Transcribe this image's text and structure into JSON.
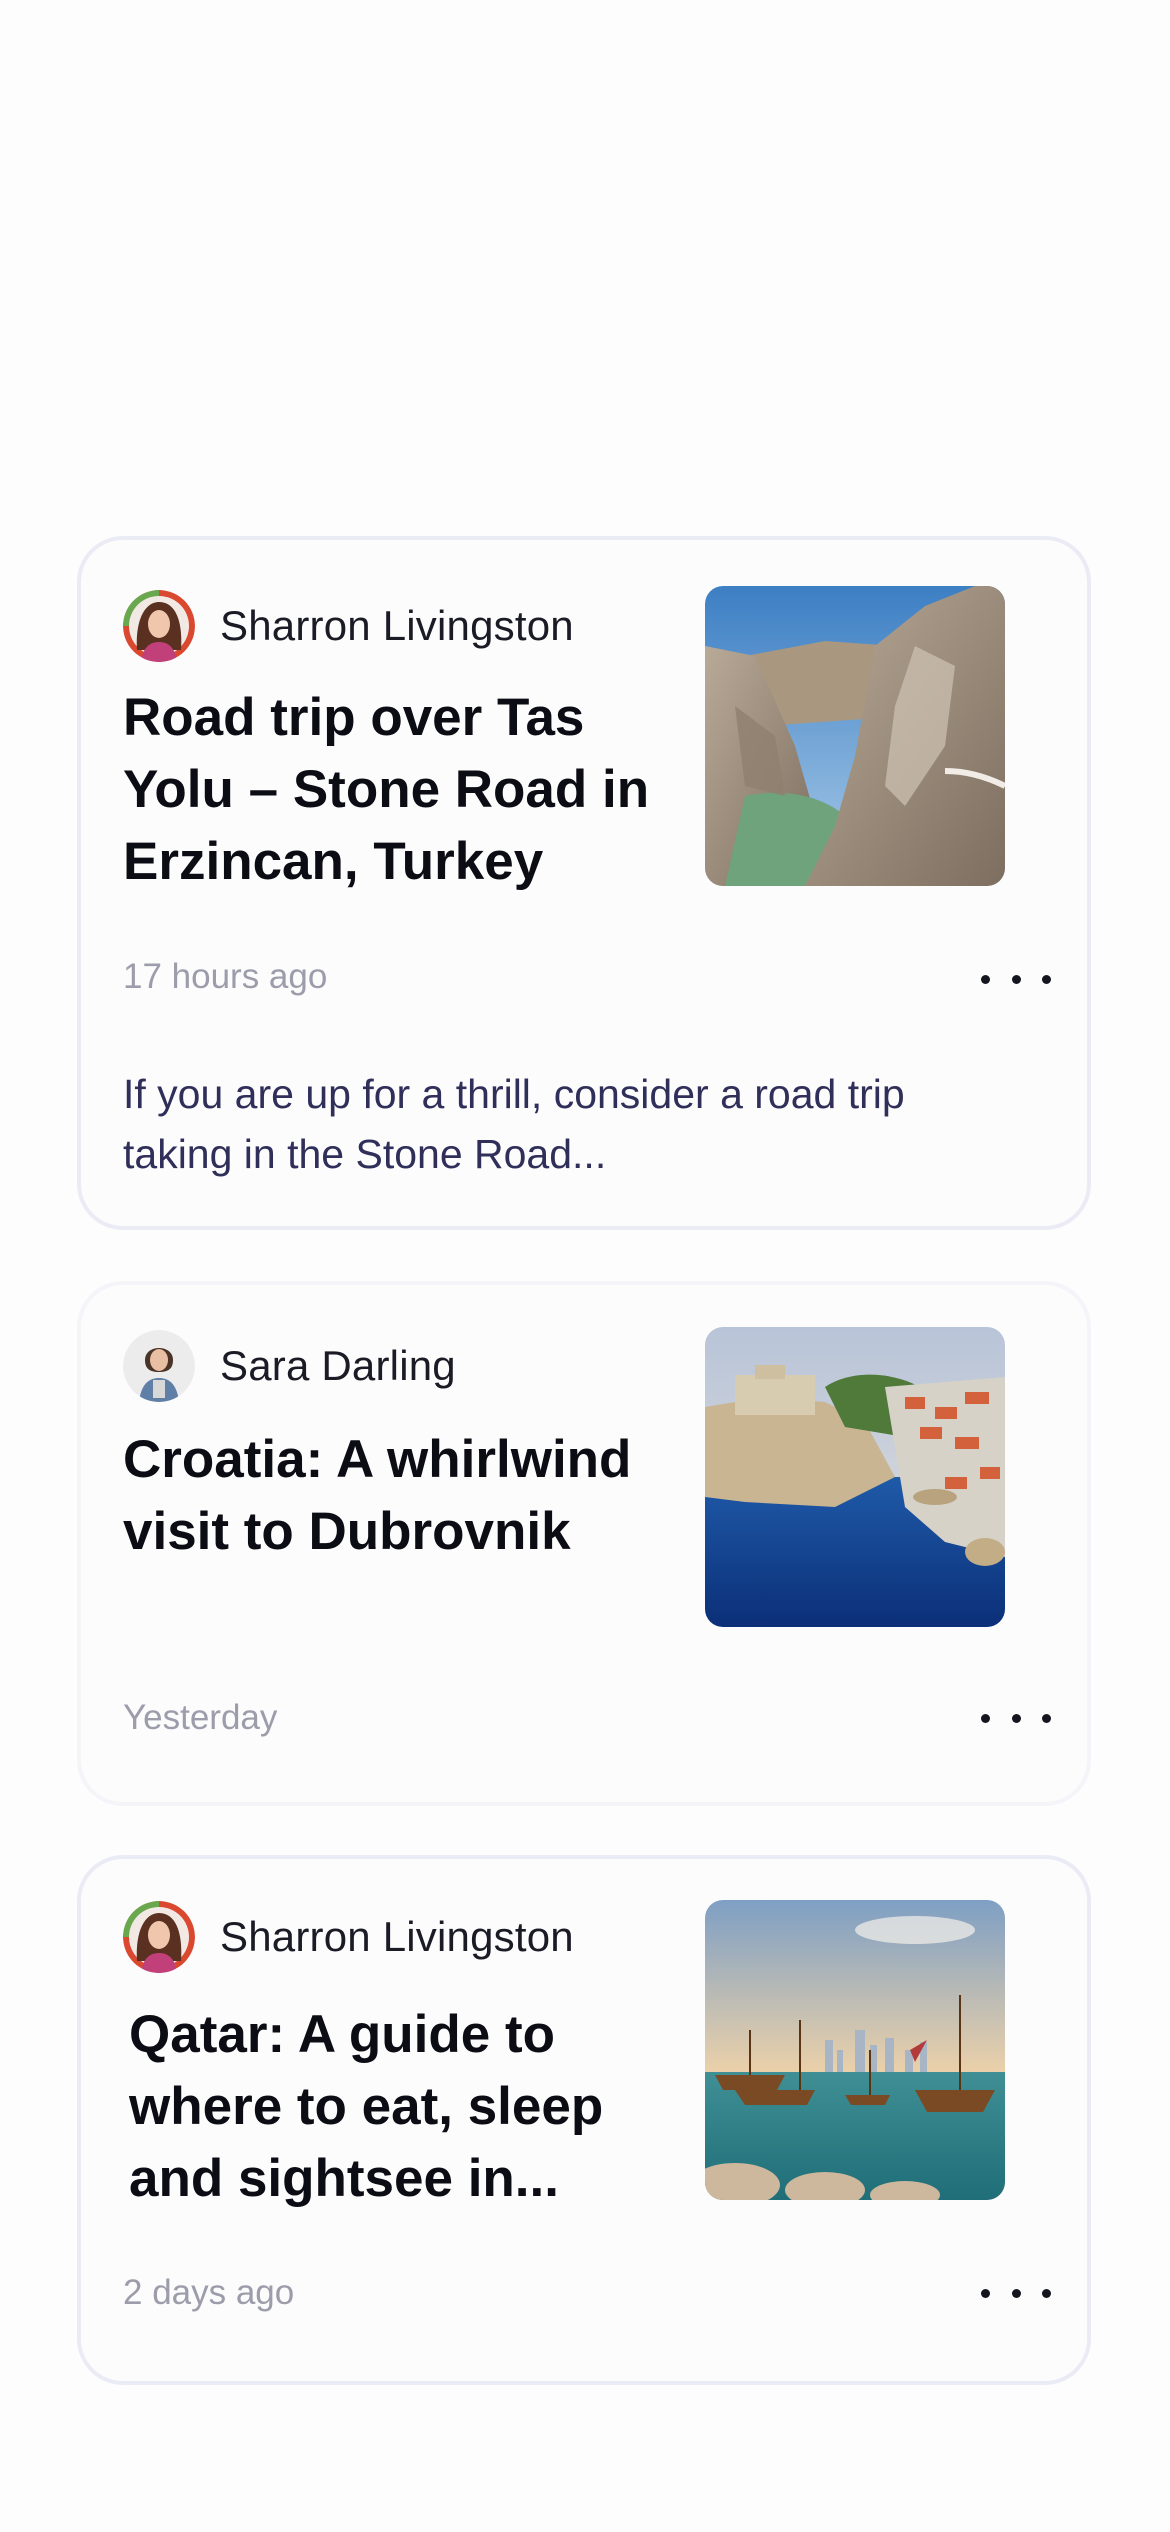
{
  "feed": {
    "cards": [
      {
        "author": "Sharron Livingston",
        "title": "Road trip over Tas Yolu – Stone Road in Erzincan, Turkey",
        "time": "17 hours ago",
        "excerpt": "If you are up for a thrill, consider a road trip taking in the Stone Road..."
      },
      {
        "author": "Sara Darling",
        "title": "Croatia: A whirlwind visit to Dubrovnik",
        "time": "Yesterday"
      },
      {
        "author": "Sharron Livingston",
        "title": "Qatar: A guide to where to eat, sleep and sightsee in...",
        "time": "2 days ago"
      }
    ]
  },
  "icons": {
    "more": "more-horizontal-icon"
  },
  "colors": {
    "card_border": "#ebebf5",
    "title": "#0c0c14",
    "timestamp": "#9c9cab",
    "excerpt": "#2f2f5a"
  }
}
